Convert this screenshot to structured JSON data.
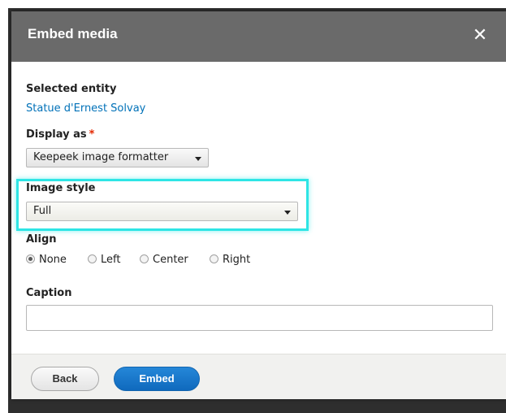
{
  "dialog": {
    "title": "Embed media",
    "close_icon": "close-icon",
    "close_glyph": "✕"
  },
  "selected_entity": {
    "label": "Selected entity",
    "value": "Statue d'Ernest Solvay"
  },
  "display_as": {
    "label": "Display as",
    "required_marker": "*",
    "value": "Keepeek image formatter"
  },
  "image_style": {
    "label": "Image style",
    "value": "Full",
    "highlight_color": "#2ee5e5"
  },
  "align": {
    "label": "Align",
    "options": [
      {
        "label": "None",
        "checked": true
      },
      {
        "label": "Left",
        "checked": false
      },
      {
        "label": "Center",
        "checked": false
      },
      {
        "label": "Right",
        "checked": false
      }
    ]
  },
  "caption": {
    "label": "Caption",
    "value": "",
    "placeholder": ""
  },
  "footer": {
    "back_label": "Back",
    "embed_label": "Embed"
  },
  "colors": {
    "titlebar": "#6a6a6a",
    "link": "#0071b8",
    "primary_button": "#1a75c9",
    "required": "#e32700"
  }
}
